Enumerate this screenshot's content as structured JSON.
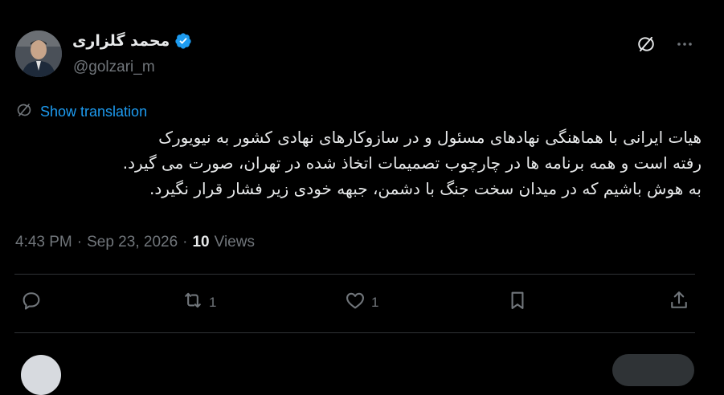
{
  "author": {
    "display_name": "محمد گلزاری",
    "handle": "@golzari_m",
    "verified": true
  },
  "translation": {
    "label": "Show translation"
  },
  "tweet": {
    "lines": [
      "هیات ایرانی با هماهنگی نهادهای مسئول و در سازوکارهای نهادی کشور به نیویورک",
      "رفته است و همه برنامه ها در چارچوب تصمیمات اتخاذ شده در تهران، صورت می گیرد.",
      "به هوش باشیم که در میدان سخت جنگ با دشمن، جبهه خودی زیر فشار قرار نگیرد."
    ]
  },
  "meta": {
    "time": "4:43 PM",
    "separator": "·",
    "date": "Sep 23, 2026",
    "views_count": "10",
    "views_label": "Views"
  },
  "actions": {
    "reply_count": "",
    "retweet_count": "1",
    "like_count": "1"
  },
  "colors": {
    "background": "#000000",
    "text": "#e7e9ea",
    "muted": "#71767b",
    "accent": "#1d9bf0",
    "divider": "#2f3336"
  },
  "icons": [
    "verified-badge-icon",
    "grok-icon",
    "more-icon",
    "translate-icon",
    "reply-icon",
    "retweet-icon",
    "like-icon",
    "bookmark-icon",
    "share-icon"
  ]
}
